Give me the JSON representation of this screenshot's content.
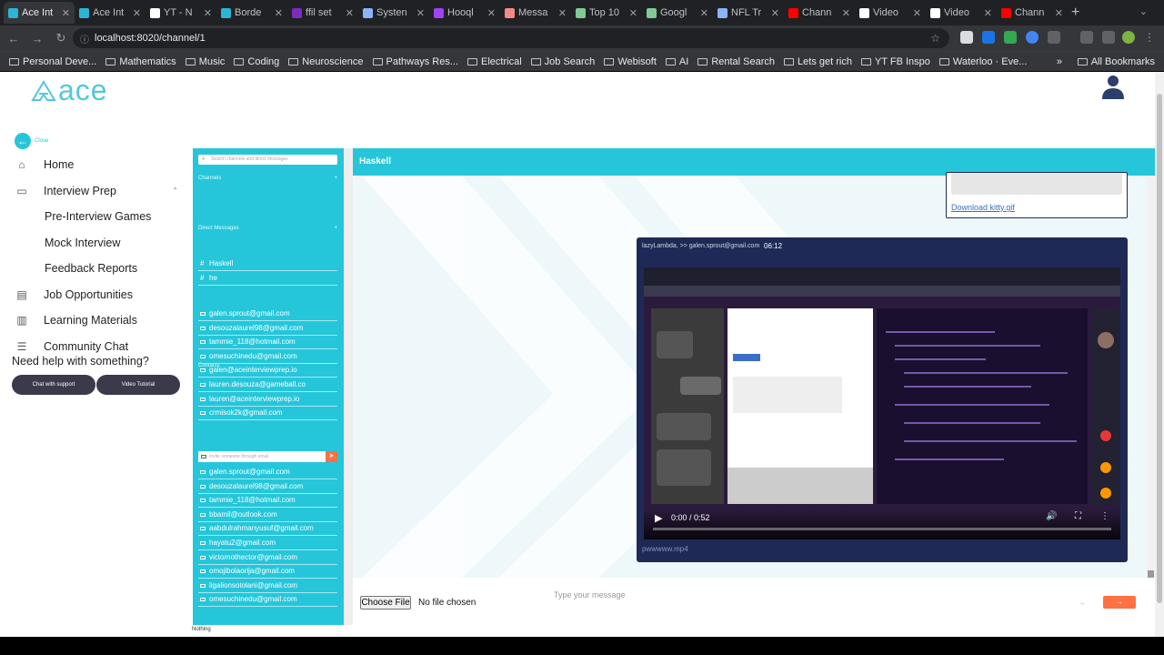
{
  "browser": {
    "tabs": [
      {
        "title": "Ace Int",
        "color": "#2bb6d3",
        "active": true
      },
      {
        "title": "Ace Int",
        "color": "#2bb6d3"
      },
      {
        "title": "YT - N",
        "color": "#ffffff"
      },
      {
        "title": "Borde",
        "color": "#2bb6d3"
      },
      {
        "title": "ffil set",
        "color": "#7b2cbf"
      },
      {
        "title": "Systen",
        "color": "#8ab4f8"
      },
      {
        "title": "Hooql",
        "color": "#a142f4"
      },
      {
        "title": "Messa",
        "color": "#f28b82"
      },
      {
        "title": "Top 10",
        "color": "#81c995"
      },
      {
        "title": "Googl",
        "color": "#81c995"
      },
      {
        "title": "NFL Tr",
        "color": "#8ab4f8"
      },
      {
        "title": "Chann",
        "color": "#ff0000"
      },
      {
        "title": "Video",
        "color": "#ffffff"
      },
      {
        "title": "Video",
        "color": "#ffffff"
      },
      {
        "title": "Chann",
        "color": "#ff0000"
      }
    ],
    "url": "localhost:8020/channel/1",
    "bookmarks": [
      "Personal Deve...",
      "Mathematics",
      "Music",
      "Coding",
      "Neuroscience",
      "Pathways Res...",
      "Electrical",
      "Job Search",
      "Webisoft",
      "AI",
      "Rental Search",
      "Lets get rich",
      "YT FB Inspo",
      "Waterloo · Eve..."
    ],
    "all_bookmarks": "All Bookmarks"
  },
  "app": {
    "logo": "ace",
    "back_label": "Close",
    "nav": [
      {
        "label": "Home",
        "icon": "home-icon",
        "sub": false
      },
      {
        "label": "Interview Prep",
        "icon": "video-camera-icon",
        "sub": false,
        "caret": true
      },
      {
        "label": "Pre-Interview Games",
        "sub": true
      },
      {
        "label": "Mock Interview",
        "sub": true
      },
      {
        "label": "Feedback Reports",
        "sub": true
      },
      {
        "label": "Job Opportunities",
        "icon": "briefcase-icon",
        "sub": false
      },
      {
        "label": "Learning Materials",
        "icon": "book-icon",
        "sub": false
      },
      {
        "label": "Community Chat",
        "icon": "chat-icon",
        "sub": false
      }
    ],
    "help_text": "Need help with something?",
    "chat_support": "Chat with support",
    "video_tutorial": "Video Tutorial"
  },
  "channels_sidebar": {
    "search_placeholder": "Search channels and direct messages",
    "channels_header": "Channels",
    "channels": [
      "Haskell",
      "he"
    ],
    "dm_header": "Direct Messages",
    "direct_messages": [
      "galen.sprout@gmail.com",
      "desouzalaurel98@gmail.com",
      "tammie_118@hotmail.com",
      "omesuchinedu@gmail.com",
      "galen@aceinterviewprep.io",
      "lauren.desouza@gameball.co",
      "lauren@aceinterviewprep.io",
      "crmisok2k@gmail.com"
    ],
    "contacts_header": "Contacts",
    "contact_placeholder": "Invite someone through email",
    "contacts": [
      "galen.sprout@gmail.com",
      "desouzalaurel98@gmail.com",
      "tammie_118@hotmail.com",
      "bbamil@outlook.com",
      "aabdulrahmanyusuf@gmail.com",
      "hayatu2@gmail.com",
      "victornothector@gmail.com",
      "omojibolaorija@gmail.com",
      "ligalionsotolani@gmail.com",
      "omesuchinedu@gmail.com"
    ],
    "footer": "Nothing"
  },
  "chat": {
    "channel_name": "Haskell",
    "kitty_link": "Download kitty.gif",
    "video_message": {
      "sender": "lazyLambda, >> galen.sprout@gmail.com",
      "time": "06:12",
      "player_time": "0:00 / 0:52",
      "filename": "pwwwww.mp4"
    },
    "choose_file": "Choose File",
    "no_file": "No file chosen",
    "message_placeholder": "Type your message",
    "send_label": "→"
  }
}
